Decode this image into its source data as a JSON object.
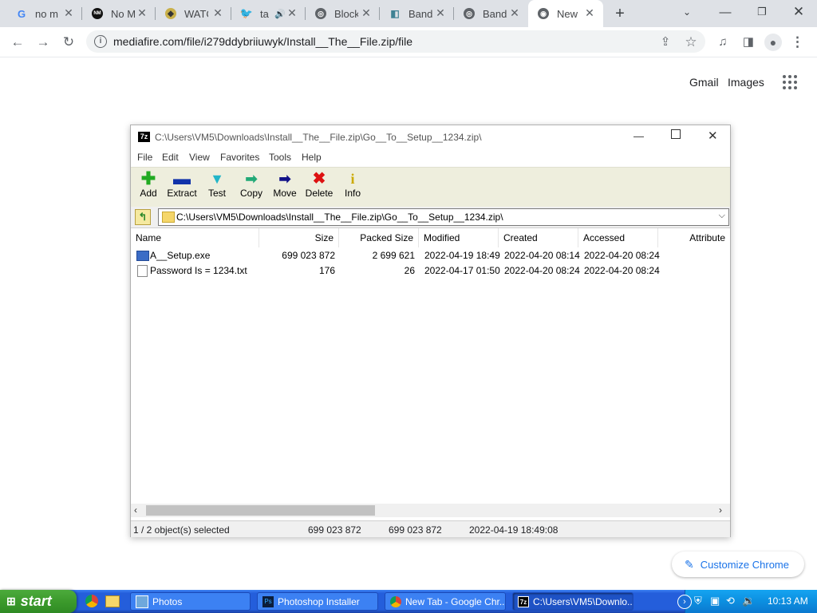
{
  "chrome": {
    "tabs": [
      {
        "title": "no m",
        "icon": "google-g-icon"
      },
      {
        "title": "No M",
        "icon": "nomad-icon"
      },
      {
        "title": "WATC",
        "icon": "watch-icon"
      },
      {
        "title": "ta",
        "icon": "twitter-icon"
      },
      {
        "title": "Block",
        "icon": "globe-icon"
      },
      {
        "title": "Band",
        "icon": "bandcamp-icon"
      },
      {
        "title": "Band",
        "icon": "globe-icon"
      },
      {
        "title": "New",
        "icon": "chrome-icon"
      }
    ],
    "new_tab_symbol": "+",
    "url": "mediafire.com/file/i279ddybriiuwyk/Install__The__File.zip/file"
  },
  "google": {
    "gmail": "Gmail",
    "images": "Images",
    "customize": "Customize Chrome"
  },
  "sevenzip": {
    "title": "C:\\Users\\VM5\\Downloads\\Install__The__File.zip\\Go__To__Setup__1234.zip\\",
    "app_icon_text": "7z",
    "menu": [
      "File",
      "Edit",
      "View",
      "Favorites",
      "Tools",
      "Help"
    ],
    "tools": [
      {
        "label": "Add",
        "icon": "add-icon",
        "color": "#22aa22"
      },
      {
        "label": "Extract",
        "icon": "extract-icon",
        "color": "#1133aa"
      },
      {
        "label": "Test",
        "icon": "test-icon",
        "color": "#22b5c8"
      },
      {
        "label": "Copy",
        "icon": "copy-icon",
        "color": "#22aa77"
      },
      {
        "label": "Move",
        "icon": "move-icon",
        "color": "#111188"
      },
      {
        "label": "Delete",
        "icon": "delete-icon",
        "color": "#dd1111"
      },
      {
        "label": "Info",
        "icon": "info-icon",
        "color": "#ccaa00"
      }
    ],
    "address": "C:\\Users\\VM5\\Downloads\\Install__The__File.zip\\Go__To__Setup__1234.zip\\",
    "columns": [
      "Name",
      "Size",
      "Packed Size",
      "Modified",
      "Created",
      "Accessed",
      "Attribute"
    ],
    "rows": [
      {
        "name": "A__Setup.exe",
        "size": "699 023 872",
        "packed": "2 699 621",
        "modified": "2022-04-19 18:49",
        "created": "2022-04-20 08:14",
        "accessed": "2022-04-20 08:24",
        "icon": "exe-icon"
      },
      {
        "name": "Password Is =   1234.txt",
        "size": "176",
        "packed": "26",
        "modified": "2022-04-17 01:50",
        "created": "2022-04-20 08:24",
        "accessed": "2022-04-20 08:24",
        "icon": "txt-icon"
      }
    ],
    "status": {
      "selected": "1 / 2 object(s) selected",
      "size": "699 023 872",
      "packed": "699 023 872",
      "date": "2022-04-19 18:49:08"
    }
  },
  "taskbar": {
    "start": "start",
    "tasks": [
      "Photos",
      "Photoshop Installer",
      "New Tab - Google Chr...",
      "C:\\Users\\VM5\\Downlo..."
    ],
    "clock": "10:13 AM"
  }
}
